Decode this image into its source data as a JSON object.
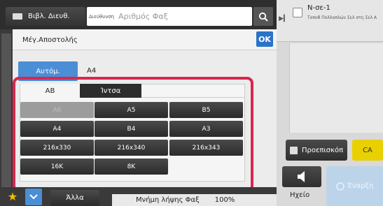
{
  "top": {
    "book_label": "Βιβλ. Διευθ.",
    "address_label": "Διεύθυνση",
    "fax_placeholder": "Αριθμός Φαξ"
  },
  "job": {
    "title": "Ν-σε-1",
    "subtitle": "Τοποθ Πολλαπλών Σελ στη Σελ Α"
  },
  "dialog": {
    "title": "Μέγ.Αποστολής",
    "ok_label": "OK",
    "auto_label": "Αυτόμ.",
    "current_size": "A4",
    "tabs": [
      "AB",
      "Ίντσα"
    ],
    "sizes": [
      {
        "label": "A6",
        "enabled": false
      },
      {
        "label": "A5",
        "enabled": true
      },
      {
        "label": "B5",
        "enabled": true
      },
      {
        "label": "A4",
        "enabled": true
      },
      {
        "label": "B4",
        "enabled": true
      },
      {
        "label": "A3",
        "enabled": true
      },
      {
        "label": "216x330",
        "enabled": true
      },
      {
        "label": "216x340",
        "enabled": true
      },
      {
        "label": "216x343",
        "enabled": true
      },
      {
        "label": "16K",
        "enabled": true
      },
      {
        "label": "8K",
        "enabled": true
      }
    ]
  },
  "right": {
    "preview_label": "Προεπισκόπ",
    "ca_label": "CA",
    "sound_label": "Ηχείο",
    "send_label": "Έναρξη"
  },
  "bottom": {
    "others_label": "Άλλα",
    "memory_label": "Μνήμη λήψης Φαξ",
    "memory_value": "100%"
  },
  "colors": {
    "accent_blue": "#4a8ed6",
    "ok_blue": "#2a73c8",
    "highlight_red": "#d9264e",
    "ca_yellow": "#e9d000",
    "send_disabled": "#bcd4ea"
  }
}
